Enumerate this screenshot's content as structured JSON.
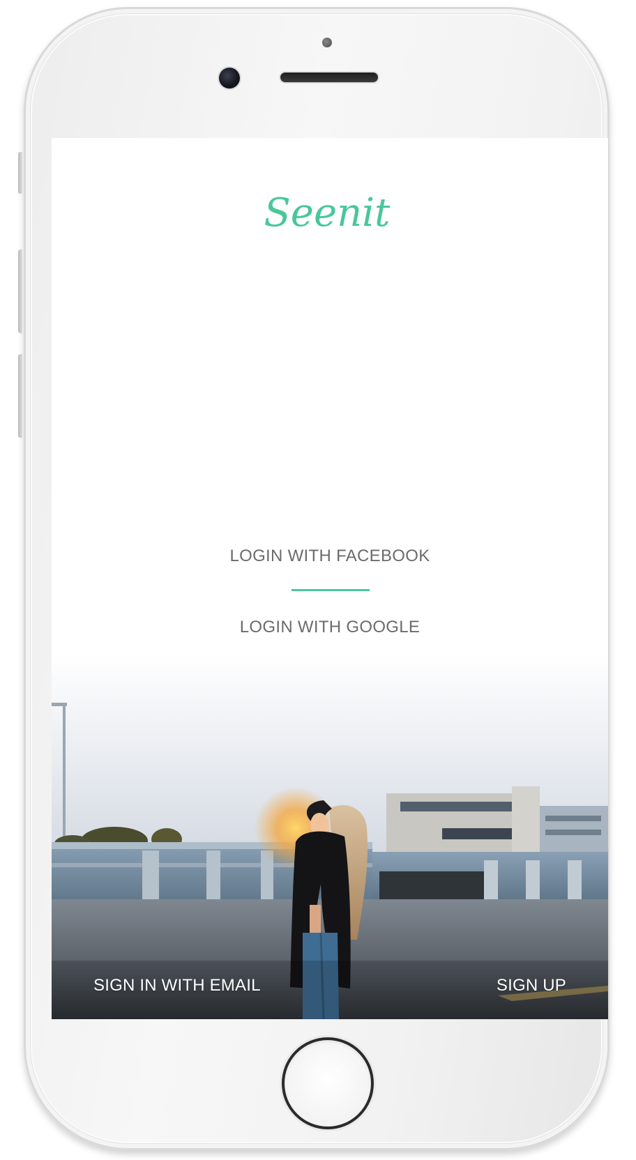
{
  "app": {
    "logo_text": "Seenit",
    "accent_color": "#49c79a"
  },
  "login": {
    "facebook_label": "LOGIN WITH FACEBOOK",
    "google_label": "LOGIN WITH GOOGLE"
  },
  "footer": {
    "sign_in_email_label": "SIGN IN WITH EMAIL",
    "sign_up_label": "SIGN UP"
  },
  "icons": {
    "home_button": "home-button-icon",
    "camera": "front-camera-icon",
    "speaker": "speaker-grille-icon"
  }
}
